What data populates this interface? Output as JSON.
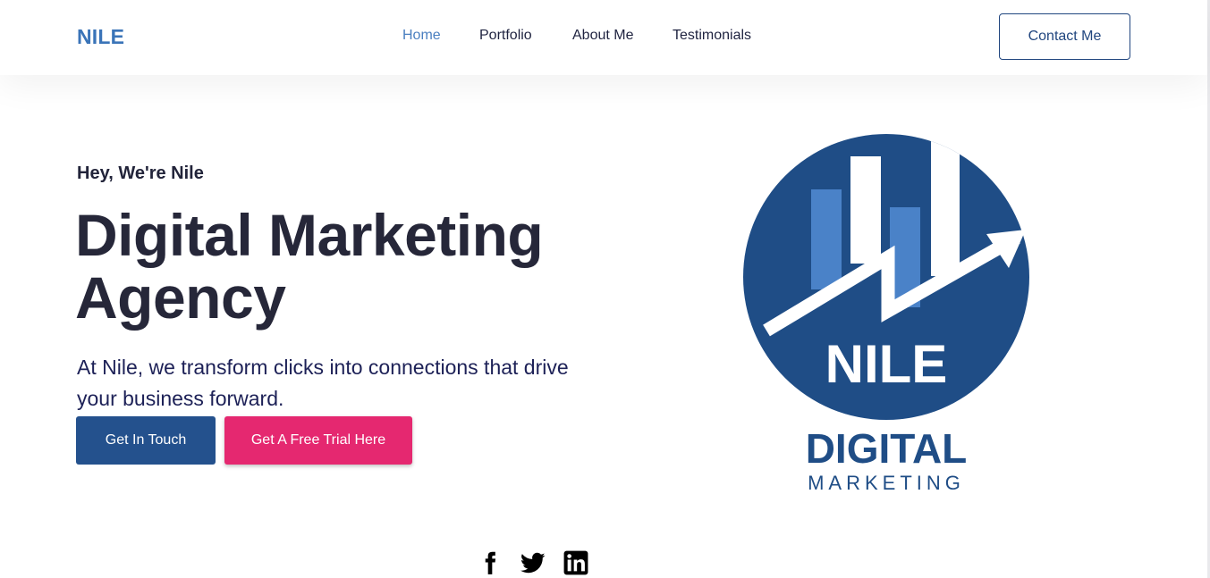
{
  "nav": {
    "brand": "NILE",
    "links": [
      "Home",
      "Portfolio",
      "About Me",
      "Testimonials"
    ],
    "active": "Home",
    "contact_label": "Contact Me"
  },
  "hero": {
    "eyebrow": "Hey, We're Nile",
    "headline_line1": "Digital Marketing",
    "headline_line2": "Agency",
    "subtext": "At Nile, we transform clicks into connections that drive your business forward.",
    "primary_button": "Get In Touch",
    "trial_button": "Get A Free Trial Here"
  },
  "logo": {
    "name": "NILE",
    "line1": "DIGITAL",
    "line2": "MARKETING"
  },
  "social": {
    "icons": [
      "facebook-icon",
      "twitter-icon",
      "linkedin-icon"
    ]
  },
  "colors": {
    "brand_blue": "#3a74b8",
    "dark_blue": "#24518d",
    "logo_blue": "#1f4d86",
    "light_bar": "#4a82c8",
    "trial_pink": "#e52870",
    "heading": "#262739"
  }
}
